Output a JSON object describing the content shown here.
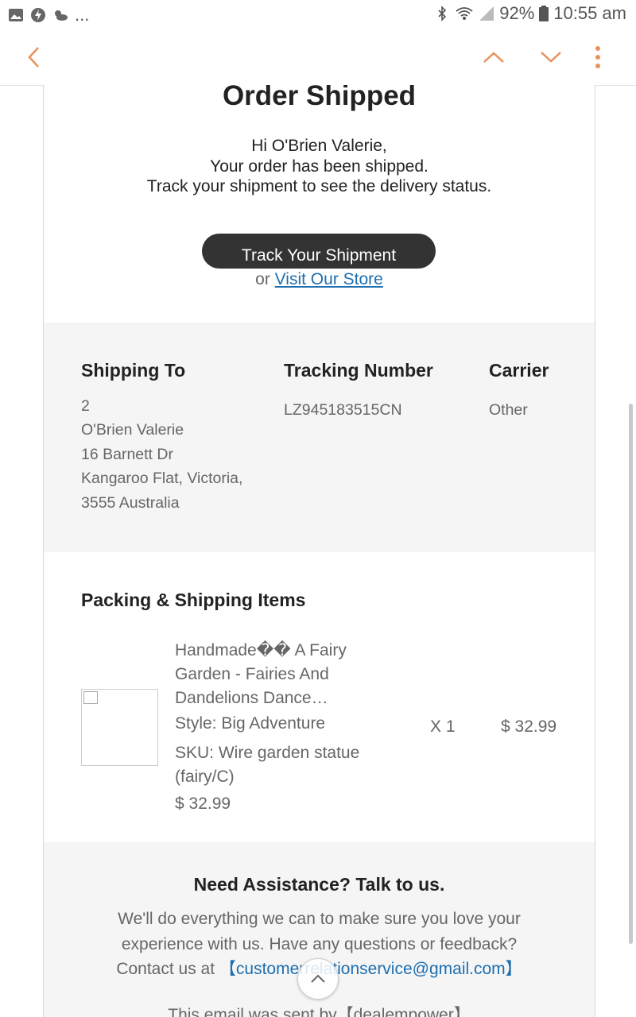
{
  "status_bar": {
    "overflow": "...",
    "battery": "92%",
    "time": "10:55 am"
  },
  "toolbar": {
    "accent_color": "#e8925a"
  },
  "email": {
    "title": "Order Shipped",
    "greeting_lines": [
      "Hi O'Brien Valerie,",
      "Your order has been shipped.",
      "Track your shipment to see the delivery status."
    ],
    "track_button": "Track Your Shipment",
    "or_text": "or",
    "visit_store_link": "Visit Our Store",
    "shipping": {
      "ship_to_header": "Shipping To",
      "ship_to_lines": [
        "2",
        "O'Brien Valerie",
        "16 Barnett Dr",
        "Kangaroo Flat, Victoria,",
        "3555 Australia"
      ],
      "tracking_header": "Tracking Number",
      "tracking_number": "LZ945183515CN",
      "carrier_header": "Carrier",
      "carrier": "Other"
    },
    "items_header": "Packing & Shipping Items",
    "item": {
      "name": "Handmade�� A Fairy Garden - Fairies And Dandelions Dance…",
      "style": "Style: Big Adventure",
      "sku": "SKU: Wire garden statue (fairy/C)",
      "price": "$ 32.99",
      "qty": "X 1",
      "total": "$ 32.99"
    },
    "assistance": {
      "header": "Need Assistance? Talk to us.",
      "text_1": "We'll do everything we can to make sure you love your experience with us. Have any questions or feedback? Contact us at",
      "email": "【customerrelationservice@gmail.com】",
      "sent_by": "This email was sent by【dealempower】"
    }
  }
}
